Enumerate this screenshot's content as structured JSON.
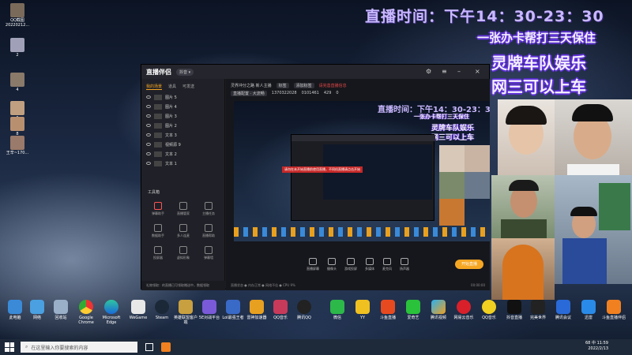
{
  "desktop_icons": [
    {
      "label": "QQ截图20220212..."
    },
    {
      "label": "2"
    },
    {
      "label": "4"
    },
    {
      "label": "6"
    },
    {
      "label": "8"
    },
    {
      "label": "王辛~170..."
    }
  ],
  "overlay": {
    "time_text": "直播时间：下午14：30-23：30",
    "line2": "一张办卡帮打三天保住",
    "line3": "灵牌车队娱乐",
    "line4": "网三可以上车"
  },
  "app": {
    "title": "直播伴侣",
    "version": "抖音 ▾",
    "tabs": [
      "我的场景",
      "道具",
      "可发送"
    ],
    "layers": [
      "图片 5",
      "图片 4",
      "图片 3",
      "图片 2",
      "文本 3",
      "视频源 9",
      "文本 2",
      "文本 1"
    ],
    "tools_label": "工具箱",
    "tools": [
      "弹幕助手",
      "直播管家",
      "主播任务",
      "数据助手",
      "多人连麦",
      "直播帮助",
      "投屏器",
      "虚拟形象",
      "弹幕墙"
    ],
    "sidebar_footer": "礼物领取：的直播已可领取赠送中，数据领取",
    "topbar": {
      "user": "灵界冲分之路 新人主播",
      "chip1": "标签",
      "chip2": "添加标签",
      "red_text": "请完善直播信息",
      "chip3": "直播配置 · 大流畅",
      "id": "1370322028",
      "stat1": "0101461",
      "stat2": "429",
      "stat3": "0"
    },
    "controls": [
      "直播屏幕",
      "摄像头",
      "游戏投屏",
      "多媒体",
      "麦克风",
      "扬声器"
    ],
    "start_label": "开始直播",
    "bottom_left": "直播状态 ● 内存正常 ● 网络不佳 ● CPU 9%",
    "bottom_right": "00:00:00",
    "warning": "请勿在未开始直播前使用直播，不同机直播请点击开始"
  },
  "taskbar_icons": [
    "此电脑",
    "网络",
    "回收站",
    "Google Chrome",
    "Microsoft Edge",
    "WeGame",
    "Steam",
    "英雄联盟客户端",
    "5E对战平台",
    "Lol最强王者",
    "雷神加速器",
    "QQ音乐",
    "腾讯QQ",
    "微信",
    "YY",
    "斗鱼直播",
    "爱奇艺",
    "腾讯视频",
    "网易云音乐",
    "QQ音乐",
    "抖音直播",
    "完美世界",
    "腾讯会议",
    "迅雷",
    "斗鱼直播伴侣"
  ],
  "search_placeholder": "在这里输入你要搜索的内容",
  "tray": {
    "time": "11:59",
    "date": "2022/2/13",
    "battery": "68",
    "lang": "中"
  },
  "colors": {
    "accent": "#f5a623",
    "overlay_purple": "#c9b8ff",
    "outline": "#5f30d8"
  }
}
